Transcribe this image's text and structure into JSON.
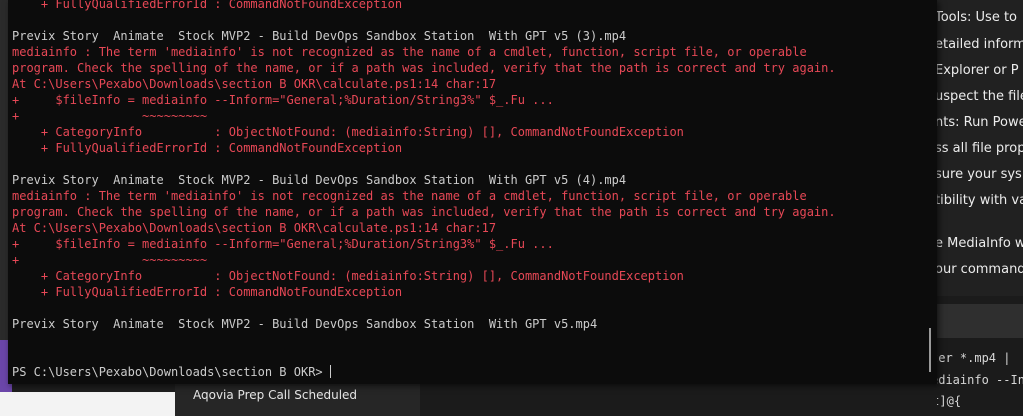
{
  "terminal": {
    "line0": "    + FullyQualifiedErrorId : CommandNotFoundException",
    "line1": "",
    "line2": "Previx Story  Animate  Stock MVP2 - Build DevOps Sandbox Station  With GPT v5 (3).mp4",
    "line3": "mediainfo : The term 'mediainfo' is not recognized as the name of a cmdlet, function, script file, or operable",
    "line4": "program. Check the spelling of the name, or if a path was included, verify that the path is correct and try again.",
    "line5": "At C:\\Users\\Pexabo\\Downloads\\section B OKR\\calculate.ps1:14 char:17",
    "line6": "+     $fileInfo = mediainfo --Inform=\"General;%Duration/String3%\" $_.Fu ...",
    "line7": "+                 ~~~~~~~~~",
    "line8": "    + CategoryInfo          : ObjectNotFound: (mediainfo:String) [], CommandNotFoundException",
    "line9": "    + FullyQualifiedErrorId : CommandNotFoundException",
    "line10": "",
    "line11": "Previx Story  Animate  Stock MVP2 - Build DevOps Sandbox Station  With GPT v5 (4).mp4",
    "line12": "mediainfo : The term 'mediainfo' is not recognized as the name of a cmdlet, function, script file, or operable",
    "line13": "program. Check the spelling of the name, or if a path was included, verify that the path is correct and try again.",
    "line14": "At C:\\Users\\Pexabo\\Downloads\\section B OKR\\calculate.ps1:14 char:17",
    "line15": "+     $fileInfo = mediainfo --Inform=\"General;%Duration/String3%\" $_.Fu ...",
    "line16": "+                 ~~~~~~~~~",
    "line17": "    + CategoryInfo          : ObjectNotFound: (mediainfo:String) [], CommandNotFoundException",
    "line18": "    + FullyQualifiedErrorId : CommandNotFoundException",
    "line19": "",
    "line20": "Previx Story  Animate  Stock MVP2 - Build DevOps Sandbox Station  With GPT v5.mp4",
    "line21": "",
    "line22": "",
    "prompt": "PS C:\\Users\\Pexabo\\Downloads\\section B OKR> "
  },
  "chat_panel": {
    "lines": [
      "Tools: Use to",
      "etailed inform",
      "Explorer or P",
      "uspect the file",
      "nts: Run Powe",
      "ss all file prop",
      "sure your sys",
      "tibility with va",
      "",
      "e MediaInfo w",
      "our command"
    ]
  },
  "code_panel": {
    "lines": [
      "ter *.mp4 |",
      "ediainfo --In",
      "[PSCustomObject]@{"
    ]
  },
  "taskbar": {
    "notification": "Aqovia Prep Call Scheduled"
  }
}
